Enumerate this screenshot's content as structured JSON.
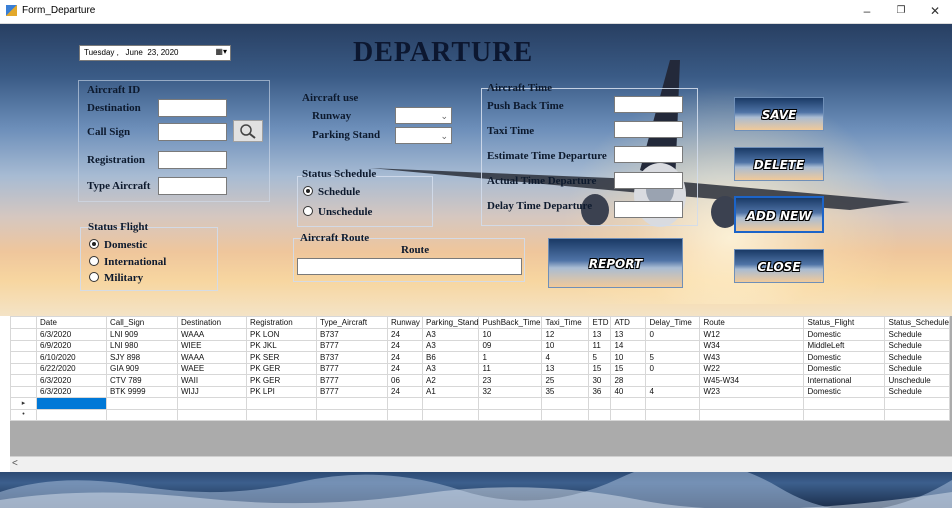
{
  "window": {
    "title": "Form_Departure",
    "minimize": "–",
    "maximize": "❐",
    "close": "✕"
  },
  "date_picker": {
    "day": "Tuesday",
    "sep1": ",",
    "month": "June",
    "date": "23, 2020",
    "btn": "▦▾"
  },
  "heading": "DEPARTURE",
  "fields": {
    "aircraft_id": "Aircraft ID",
    "destination": "Destination",
    "call_sign": "Call Sign",
    "registration": "Registration",
    "type_aircraft": "Type Aircraft"
  },
  "aircraft_use": {
    "title": "Aircraft use",
    "runway": "Runway",
    "parking_stand": "Parking Stand",
    "arrow": "⌄"
  },
  "status_schedule": {
    "title": "Status Schedule",
    "schedule": "Schedule",
    "unschedule": "Unschedule"
  },
  "status_flight": {
    "title": "Status Flight",
    "domestic": "Domestic",
    "international": "International",
    "military": "Military"
  },
  "aircraft_route": {
    "title": "Aircraft Route",
    "route": "Route"
  },
  "aircraft_time": {
    "title": "Aircraft Time",
    "push_back": "Push Back Time",
    "taxi": "Taxi Time",
    "etd": "Estimate Time Departure",
    "atd": "Actual Time Departure",
    "delay": "Delay Time Departure"
  },
  "buttons": {
    "save": "SAVE",
    "delete": "DELETE",
    "add_new": "ADD NEW",
    "close": "CLOSE",
    "report": "REPORT"
  },
  "colors": {
    "accent": "#0078d7",
    "sky_top": "#283f62",
    "sky_bottom": "#f4e3c6"
  },
  "grid": {
    "columns": [
      "Date",
      "Call_Sign",
      "Destination",
      "Registration",
      "Type_Aircraft",
      "Runway",
      "Parking_Stand",
      "PushBack_Time",
      "Taxi_Time",
      "ETD",
      "ATD",
      "Delay_Time",
      "Route",
      "Status_Flight",
      "Status_Schedule"
    ],
    "rows": [
      [
        "6/3/2020",
        "LNI 909",
        "WAAA",
        "PK LON",
        "B737",
        "24",
        "A3",
        "10",
        "12",
        "13",
        "13",
        "0",
        "W12",
        "Domestic",
        "Schedule"
      ],
      [
        "6/9/2020",
        "LNI 980",
        "WIEE",
        "PK JKL",
        "B777",
        "24",
        "A3",
        "09",
        "10",
        "11",
        "14",
        "",
        "W34",
        "MiddleLeft",
        "Schedule"
      ],
      [
        "6/10/2020",
        "SJY 898",
        "WAAA",
        "PK SER",
        "B737",
        "24",
        "B6",
        "1",
        "4",
        "5",
        "10",
        "5",
        "W43",
        "Domestic",
        "Schedule"
      ],
      [
        "6/22/2020",
        "GIA 909",
        "WAEE",
        "PK GER",
        "B777",
        "24",
        "A3",
        "11",
        "13",
        "15",
        "15",
        "0",
        "W22",
        "Domestic",
        "Schedule"
      ],
      [
        "6/3/2020",
        "CTV 789",
        "WAII",
        "PK GER",
        "B777",
        "06",
        "A2",
        "23",
        "25",
        "30",
        "28",
        "",
        "W45-W34",
        "International",
        "Unschedule"
      ],
      [
        "6/3/2020",
        "BTK 9999",
        "WIJJ",
        "PK LPI",
        "B777",
        "24",
        "A1",
        "32",
        "35",
        "36",
        "40",
        "4",
        "W23",
        "Domestic",
        "Schedule"
      ]
    ],
    "new_row_marker": "▸",
    "star_marker": "•",
    "scroll_left": "<"
  }
}
